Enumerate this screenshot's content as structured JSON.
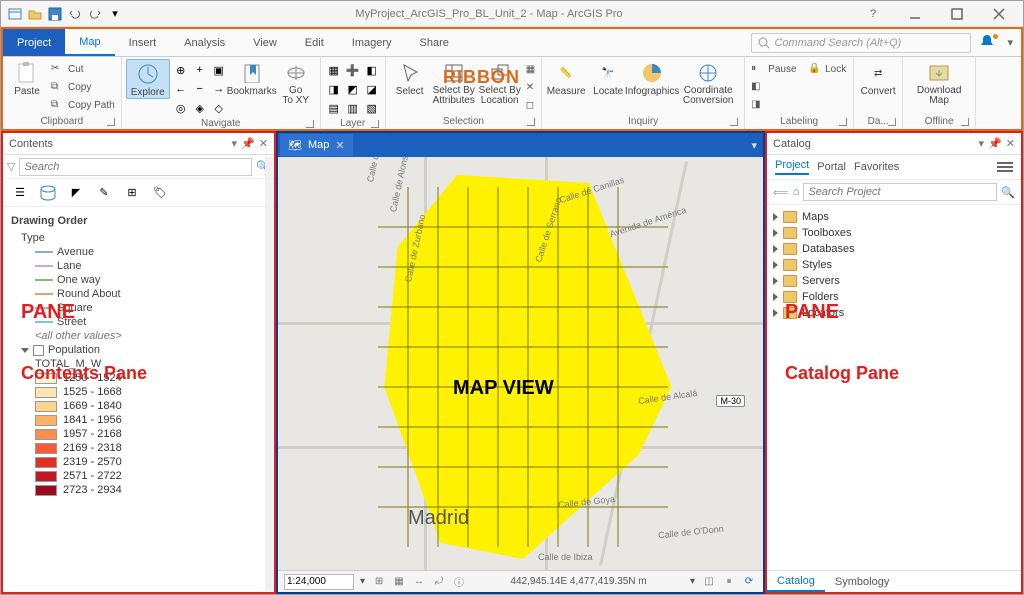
{
  "titlebar": {
    "title": "MyProject_ArcGIS_Pro_BL_Unit_2 - Map - ArcGIS Pro"
  },
  "tabs": {
    "project": "Project",
    "items": [
      "Map",
      "Insert",
      "Analysis",
      "View",
      "Edit",
      "Imagery",
      "Share"
    ],
    "active": "Map",
    "command_search_placeholder": "Command Search (Alt+Q)"
  },
  "ribbon": {
    "clipboard": {
      "label": "Clipboard",
      "paste": "Paste",
      "cut": "Cut",
      "copy": "Copy",
      "copy_path": "Copy Path"
    },
    "navigate": {
      "label": "Navigate",
      "explore": "Explore",
      "bookmarks": "Bookmarks",
      "goto": "Go\nTo XY"
    },
    "layer": {
      "label": "Layer"
    },
    "selection": {
      "label": "Selection",
      "select": "Select",
      "by_attr": "Select By\nAttributes",
      "by_loc": "Select By\nLocation"
    },
    "inquiry": {
      "label": "Inquiry",
      "measure": "Measure",
      "locate": "Locate",
      "infographics": "Infographics",
      "coord": "Coordinate\nConversion"
    },
    "labeling": {
      "label": "Labeling",
      "pause": "Pause",
      "lock": "Lock"
    },
    "data": {
      "label": "Da...",
      "convert": "Convert"
    },
    "offline": {
      "label": "Offline",
      "download": "Download\nMap"
    },
    "annot": "RIBBON"
  },
  "contents": {
    "title": "Contents",
    "search_placeholder": "Search",
    "drawing_order": "Drawing Order",
    "type_label": "Type",
    "types": [
      {
        "name": "Avenue",
        "color": "#8fa8d6"
      },
      {
        "name": "Lane",
        "color": "#d4a4d4"
      },
      {
        "name": "One way",
        "color": "#7cc27c"
      },
      {
        "name": "Round About",
        "color": "#e0a070"
      },
      {
        "name": "Square",
        "color": "#e89aa8"
      },
      {
        "name": "Street",
        "color": "#80c8c8"
      }
    ],
    "all_other": "<all other values>",
    "population_label": "Population",
    "total_label": "TOTAL_M_W",
    "legend": [
      {
        "range": "1250 - 1524",
        "color": "#fff5d6"
      },
      {
        "range": "1525 - 1668",
        "color": "#fee6b0"
      },
      {
        "range": "1669 - 1840",
        "color": "#fdd58b"
      },
      {
        "range": "1841 - 1956",
        "color": "#fdb264"
      },
      {
        "range": "1957 - 2168",
        "color": "#fc8d4a"
      },
      {
        "range": "2169 - 2318",
        "color": "#f45b36"
      },
      {
        "range": "2319 - 2570",
        "color": "#e03124"
      },
      {
        "range": "2571 - 2722",
        "color": "#c31820"
      },
      {
        "range": "2723 - 2934",
        "color": "#9a0c1c"
      }
    ],
    "annot_pane": "PANE",
    "annot_title": "Contents Pane"
  },
  "map": {
    "tab_label": "Map",
    "city_label": "Madrid",
    "streets": [
      "Calle de Ponzano",
      "Calle de Alonso Cano",
      "Calle de Zurbano",
      "Calle de Serrano",
      "Calle de Canillas",
      "Avenida de América",
      "Calle de Alcalá",
      "Calle de Ibiza",
      "Calle de O'Donn",
      "Calle de Goya"
    ],
    "annot": "MAP VIEW",
    "route_badge": "M-30",
    "status": {
      "scale": "1:24,000",
      "coords": "442,945.14E 4,477,419.35N m"
    }
  },
  "catalog": {
    "title": "Catalog",
    "tabs": [
      "Project",
      "Portal",
      "Favorites"
    ],
    "active_tab": "Project",
    "search_placeholder": "Search Project",
    "items": [
      "Maps",
      "Toolboxes",
      "Databases",
      "Styles",
      "Servers",
      "Folders",
      "Locators"
    ],
    "annot_pane": "PANE",
    "annot_title": "Catalog Pane",
    "bottom_tabs": [
      "Catalog",
      "Symbology"
    ],
    "bottom_active": "Catalog"
  }
}
